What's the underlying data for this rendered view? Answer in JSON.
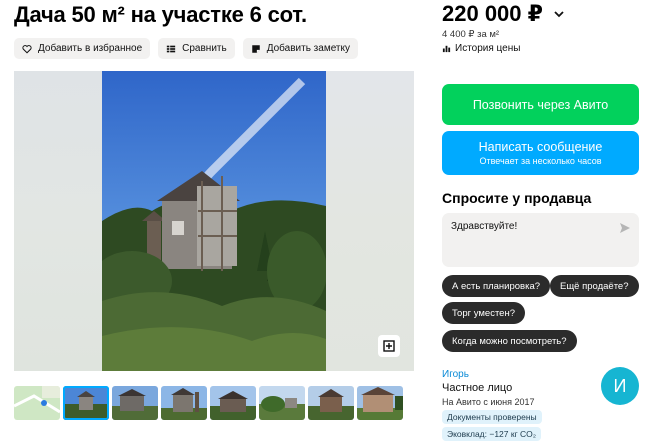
{
  "listing": {
    "title": "Дача 50 м² на участке 6 сот."
  },
  "actions": {
    "favorite": "Добавить в избранное",
    "compare": "Сравнить",
    "note": "Добавить заметку"
  },
  "price": {
    "value": "220 000 ₽",
    "per_m2": "4 400 ₽ за м²",
    "history": "История цены"
  },
  "contact": {
    "call": "Позвонить через Авито",
    "message": "Написать сообщение",
    "message_sub": "Отвечает за несколько часов"
  },
  "ask": {
    "title": "Спросите у продавца",
    "input_value": "Здравствуйте!",
    "chips": [
      "А есть планировка?",
      "Ещё продаёте?",
      "Торг уместен?",
      "Когда можно посмотреть?"
    ]
  },
  "seller": {
    "name": "Игорь",
    "type": "Частное лицо",
    "since": "На Авито с июня 2017",
    "avatar_letter": "И",
    "badges": [
      "Документы проверены",
      "Эковклад: −127 кг CO₂"
    ]
  },
  "colors": {
    "call": "#02d15c",
    "message": "#00aaff",
    "avatar": "#16b5d2",
    "link": "#0a8ad6"
  },
  "icons": {
    "favorite": "heart-icon",
    "compare": "compare-icon",
    "note": "note-icon",
    "price_dropdown": "chevron-down-icon",
    "history": "chart-icon",
    "send": "send-icon",
    "expand": "expand-icon"
  }
}
